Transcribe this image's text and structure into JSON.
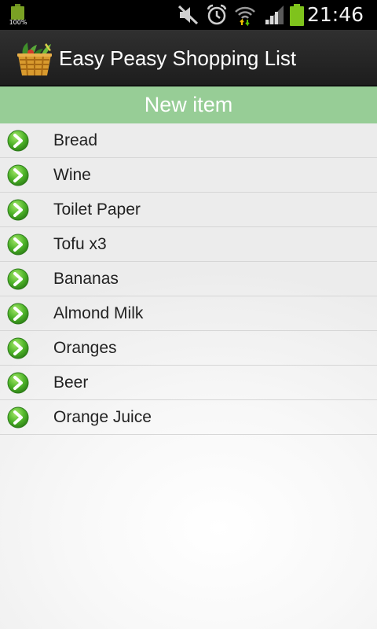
{
  "status_bar": {
    "battery_left_percent": "100%",
    "icons": [
      "battery-icon",
      "mute-icon",
      "alarm-icon",
      "wifi-icon",
      "signal-icon",
      "battery-icon"
    ],
    "time": "21:46"
  },
  "action_bar": {
    "icon": "shopping-basket-icon",
    "title": "Easy Peasy Shopping List"
  },
  "new_item_label": "New item",
  "items": [
    {
      "label": "Bread",
      "icon": "green-arrow-icon"
    },
    {
      "label": "Wine",
      "icon": "green-arrow-icon"
    },
    {
      "label": "Toilet Paper",
      "icon": "green-arrow-icon"
    },
    {
      "label": "Tofu x3",
      "icon": "green-arrow-icon"
    },
    {
      "label": "Bananas",
      "icon": "green-arrow-icon"
    },
    {
      "label": "Almond Milk",
      "icon": "green-arrow-icon"
    },
    {
      "label": "Oranges",
      "icon": "green-arrow-icon"
    },
    {
      "label": "Beer",
      "icon": "green-arrow-icon"
    },
    {
      "label": "Orange Juice",
      "icon": "green-arrow-icon"
    }
  ],
  "colors": {
    "new_item_bar": "#97cd96",
    "action_bar": "#262626",
    "arrow_green": "#3fae1f",
    "battery_green": "#7fc31c"
  }
}
